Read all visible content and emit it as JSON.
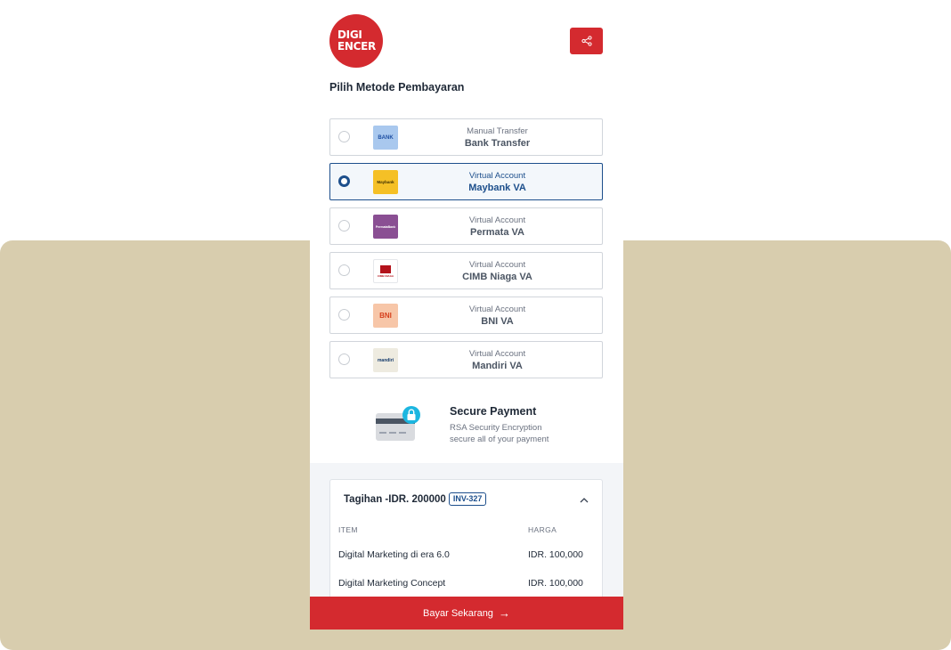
{
  "brand": {
    "logo_line1": "DIGI",
    "logo_line2": "ENCER",
    "color": "#d42a2f"
  },
  "header": {
    "share_icon": "share-icon"
  },
  "title": "Pilih Metode Pembayaran",
  "payment_methods": [
    {
      "type": "Manual Transfer",
      "name": "Bank Transfer",
      "logo_text": "BANK",
      "logo_bg": "#a9c8ee",
      "logo_fg": "#1e4fa3",
      "selected": false
    },
    {
      "type": "Virtual Account",
      "name": "Maybank VA",
      "logo_text": "Maybank",
      "logo_bg": "#f5c026",
      "logo_fg": "#3a2c00",
      "selected": true
    },
    {
      "type": "Virtual Account",
      "name": "Permata VA",
      "logo_text": "PermataBank",
      "logo_bg": "#8a4f93",
      "logo_fg": "#ffffff",
      "selected": false
    },
    {
      "type": "Virtual Account",
      "name": "CIMB Niaga VA",
      "logo_text": "CIMB NIAGA",
      "logo_bg": "#ffffff",
      "logo_fg": "#b3121b",
      "selected": false
    },
    {
      "type": "Virtual Account",
      "name": "BNI VA",
      "logo_text": "BNI",
      "logo_bg": "#f7c6a8",
      "logo_fg": "#d6401c",
      "selected": false
    },
    {
      "type": "Virtual Account",
      "name": "Mandiri VA",
      "logo_text": "mandiri",
      "logo_bg": "#eeebe0",
      "logo_fg": "#143a6b",
      "selected": false
    }
  ],
  "secure": {
    "title": "Secure Payment",
    "desc_line1": "RSA Security Encryption",
    "desc_line2": "secure all of your payment"
  },
  "bill": {
    "label": "Tagihan -IDR. 200000",
    "invoice": "INV-327",
    "col_item": "ITEM",
    "col_price": "HARGA",
    "rows": [
      {
        "item": "Digital Marketing di era 6.0",
        "price": "IDR. 100,000"
      },
      {
        "item": "Digital Marketing Concept",
        "price": "IDR. 100,000"
      }
    ]
  },
  "pay_button": "Bayar Sekarang",
  "colors": {
    "accent_red": "#d42a2f",
    "selected_blue": "#1d4f8c",
    "backdrop": "#d8cdae"
  }
}
